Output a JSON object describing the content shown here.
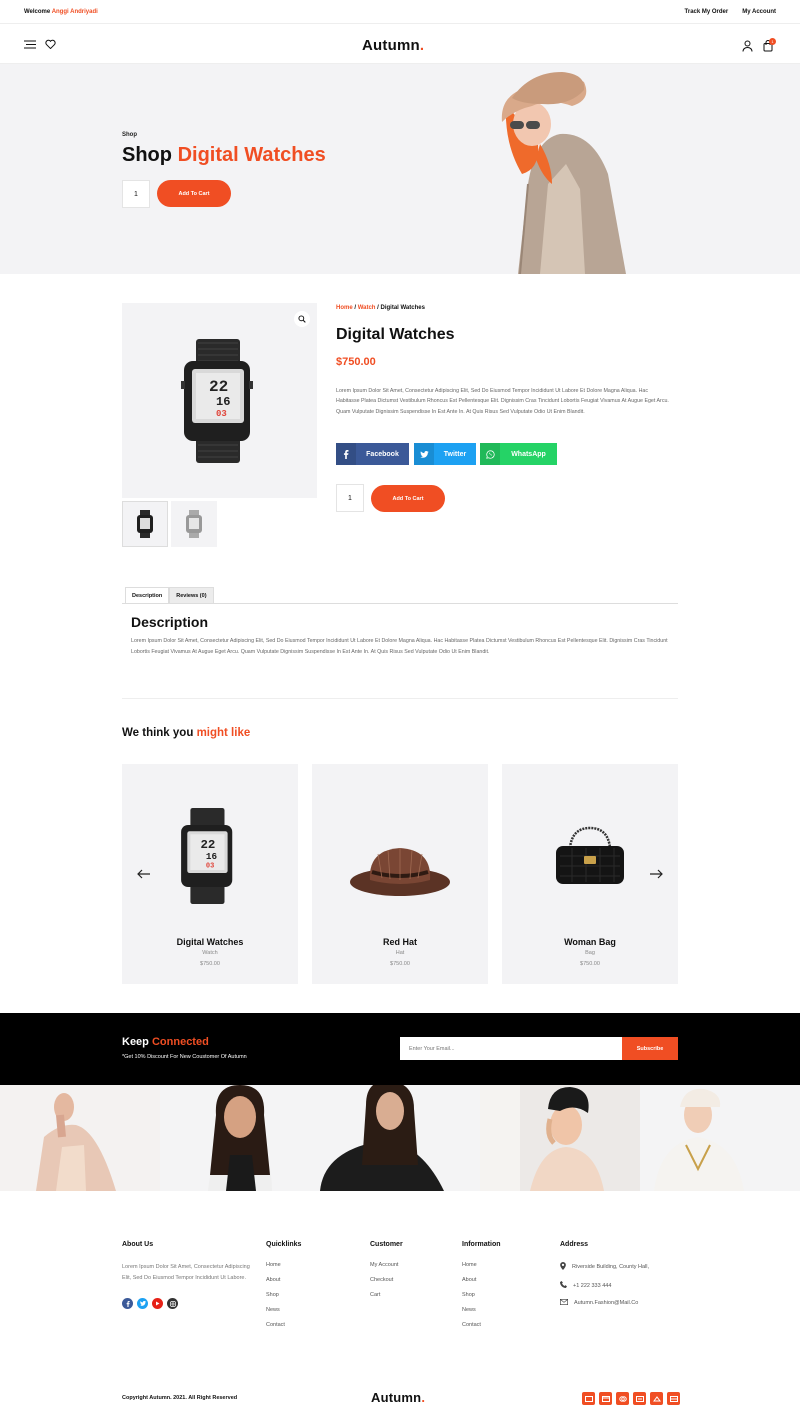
{
  "topbar": {
    "welcome_label": "Welcome",
    "user_name": "Anggi Andriyadi",
    "track_order": "Track My Order",
    "my_account": "My Account"
  },
  "header": {
    "logo_text": "Autumn",
    "logo_dot": ".",
    "cart_count": "1",
    "icons": [
      "menu-icon",
      "heart-icon",
      "user-icon",
      "cart-icon"
    ]
  },
  "hero": {
    "breadcrumb": "Shop",
    "title_prefix": "Shop",
    "title_highlight": "Digital Watches",
    "quantity": "1",
    "add_to_cart": "Add To Cart"
  },
  "product": {
    "breadcrumb": {
      "home": "Home",
      "category": "Watch",
      "current": "Digital Watches",
      "separator": "/"
    },
    "title": "Digital Watches",
    "price": "$750.00",
    "description": "Lorem Ipsum Dolor Sit Amet, Consectetur Adipiscing Elit, Sed Do Eiusmod Tempor Incididunt Ut Labore Et Dolore Magna Aliqua. Hac Habitasse Platea Dictumst Vestibulum Rhoncus Est Pellentesque Elit. Dignissim Cras Tincidunt Lobortis Feugiat Vivamus At Augue Eget Arcu. Quam Vulputate Dignissim Suspendisse In Est Ante In. At Quis Risus Sed Vulputate Odio Ut Enim Blandit.",
    "share": [
      {
        "label": "Facebook",
        "color": "#3b5998",
        "icon": "facebook-icon"
      },
      {
        "label": "Twitter",
        "color": "#1da1f2",
        "icon": "twitter-icon"
      },
      {
        "label": "WhatsApp",
        "color": "#25d366",
        "icon": "whatsapp-icon"
      }
    ],
    "quantity": "1",
    "add_to_cart": "Add To Cart"
  },
  "tabs": {
    "description": "Description",
    "reviews": "Reviews (0)"
  },
  "description_section": {
    "heading": "Description",
    "text": "Lorem Ipsum Dolor Sit Amet, Consectetur Adipiscing Elit, Sed Do Eiusmod Tempor Incididunt Ut Labore Et Dolore Magna Aliqua. Hac Habitasse Platea Dictumst Vestibulum Rhoncus Est Pellentesque Elit. Dignissim Cras Tincidunt Lobortis Feugiat Vivamus At Augue Eget Arcu. Quam Vulputate Dignissim Suspendisse In Est Ante In. At Quis Risus Sed Vulputate Odio Ut Enim Blandit."
  },
  "related": {
    "heading_prefix": "We think you",
    "heading_highlight": "might like",
    "items": [
      {
        "name": "Digital Watches",
        "category": "Watch",
        "price": "$750.00"
      },
      {
        "name": "Red Hat",
        "category": "Hat",
        "price": "$750.00"
      },
      {
        "name": "Woman Bag",
        "category": "Bag",
        "price": "$750.00"
      }
    ]
  },
  "newsletter": {
    "heading_prefix": "Keep",
    "heading_highlight": "Connected",
    "subtext": "*Get 10% Discount For New Coustomer Of Autumn",
    "email_placeholder": "Enter Your Email...",
    "subscribe": "Subscribe"
  },
  "footer": {
    "about": {
      "heading": "About Us",
      "text": "Lorem Ipsum Dolor Sit Amet, Consectetur Adipiscing Elit, Sed Do Eiusmod Tempor Incididunt Ut Labore.",
      "social": [
        {
          "icon": "facebook-icon",
          "color": "#3b5998"
        },
        {
          "icon": "twitter-icon",
          "color": "#1da1f2"
        },
        {
          "icon": "youtube-icon",
          "color": "#e62117"
        },
        {
          "icon": "instagram-icon",
          "color": "#333333"
        }
      ]
    },
    "quicklinks": {
      "heading": "Quicklinks",
      "items": [
        "Home",
        "About",
        "Shop",
        "News",
        "Contact"
      ]
    },
    "customer": {
      "heading": "Customer",
      "items": [
        "My Account",
        "Checkout",
        "Cart"
      ]
    },
    "information": {
      "heading": "Information",
      "items": [
        "Home",
        "About",
        "Shop",
        "News",
        "Contact"
      ]
    },
    "address": {
      "heading": "Address",
      "location": "Riverside Building, County Hall,",
      "phone": "+1 222 333 444",
      "email": "Autumn.Fashion@Mail.Co"
    },
    "copyright": "Copyright Autumn. 2021. All Right Reserved",
    "logo_text": "Autumn",
    "logo_dot": ".",
    "payment_icons": [
      "payment-icon-1",
      "payment-icon-2",
      "payment-icon-3",
      "payment-icon-4",
      "payment-icon-5",
      "payment-icon-6"
    ]
  },
  "colors": {
    "accent": "#f04e23",
    "light_bg": "#f3f3f5",
    "dark": "#000000"
  }
}
